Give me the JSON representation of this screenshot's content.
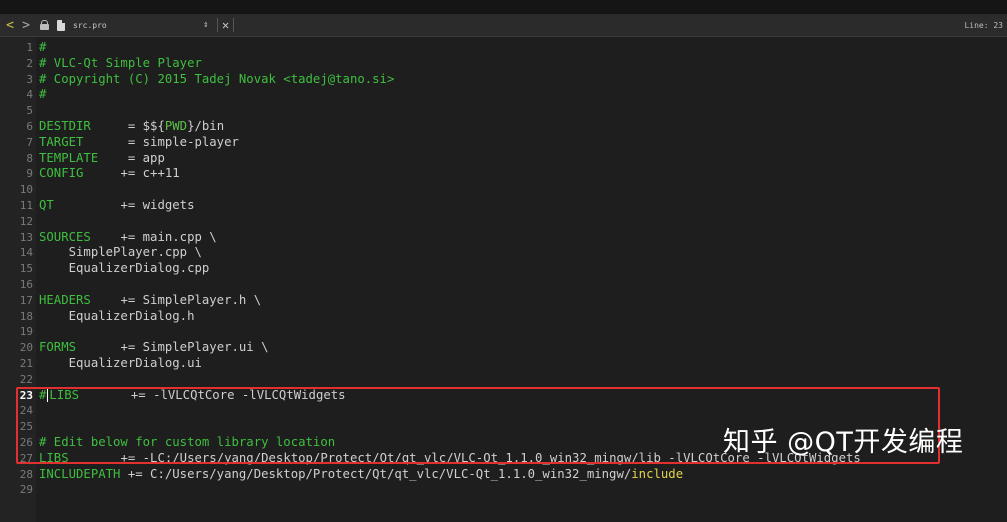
{
  "titlebar": {
    "back_glyph": "<",
    "forward_glyph": ">",
    "filename": "src.pro",
    "updown_glyph": "⇕",
    "close_glyph": "✕",
    "line_status": "Line: 23"
  },
  "editor": {
    "current_line": 23,
    "lines": [
      {
        "n": "1",
        "segs": [
          {
            "t": "#",
            "c": "c-comment"
          }
        ]
      },
      {
        "n": "2",
        "segs": [
          {
            "t": "# VLC-Qt Simple Player",
            "c": "c-comment"
          }
        ]
      },
      {
        "n": "3",
        "segs": [
          {
            "t": "# Copyright (C) 2015 Tadej Novak <tadej@tano.si>",
            "c": "c-comment"
          }
        ]
      },
      {
        "n": "4",
        "segs": [
          {
            "t": "#",
            "c": "c-comment"
          }
        ]
      },
      {
        "n": "5",
        "segs": []
      },
      {
        "n": "6",
        "segs": [
          {
            "t": "DESTDIR",
            "c": "c-var"
          },
          {
            "t": "     = $${",
            "c": "c-plain"
          },
          {
            "t": "PWD",
            "c": "c-pwd"
          },
          {
            "t": "}/bin",
            "c": "c-plain"
          }
        ]
      },
      {
        "n": "7",
        "segs": [
          {
            "t": "TARGET",
            "c": "c-var"
          },
          {
            "t": "      = simple-player",
            "c": "c-plain"
          }
        ]
      },
      {
        "n": "8",
        "segs": [
          {
            "t": "TEMPLATE",
            "c": "c-var"
          },
          {
            "t": "    = app",
            "c": "c-plain"
          }
        ]
      },
      {
        "n": "9",
        "segs": [
          {
            "t": "CONFIG",
            "c": "c-var"
          },
          {
            "t": "     += c++11",
            "c": "c-plain"
          }
        ]
      },
      {
        "n": "10",
        "segs": []
      },
      {
        "n": "11",
        "segs": [
          {
            "t": "QT",
            "c": "c-var"
          },
          {
            "t": "         += widgets",
            "c": "c-plain"
          }
        ]
      },
      {
        "n": "12",
        "segs": []
      },
      {
        "n": "13",
        "segs": [
          {
            "t": "SOURCES",
            "c": "c-var"
          },
          {
            "t": "    += main.cpp \\",
            "c": "c-plain"
          }
        ]
      },
      {
        "n": "14",
        "segs": [
          {
            "t": "    SimplePlayer.cpp \\",
            "c": "c-plain"
          }
        ]
      },
      {
        "n": "15",
        "segs": [
          {
            "t": "    EqualizerDialog.cpp",
            "c": "c-plain"
          }
        ]
      },
      {
        "n": "16",
        "segs": []
      },
      {
        "n": "17",
        "segs": [
          {
            "t": "HEADERS",
            "c": "c-var"
          },
          {
            "t": "    += SimplePlayer.h \\",
            "c": "c-plain"
          }
        ]
      },
      {
        "n": "18",
        "segs": [
          {
            "t": "    EqualizerDialog.h",
            "c": "c-plain"
          }
        ]
      },
      {
        "n": "19",
        "segs": []
      },
      {
        "n": "20",
        "segs": [
          {
            "t": "FORMS",
            "c": "c-var"
          },
          {
            "t": "      += SimplePlayer.ui \\",
            "c": "c-plain"
          }
        ]
      },
      {
        "n": "21",
        "segs": [
          {
            "t": "    EqualizerDialog.ui",
            "c": "c-plain"
          }
        ]
      },
      {
        "n": "22",
        "segs": []
      },
      {
        "n": "23",
        "segs": [
          {
            "t": "#",
            "c": "c-comment"
          },
          {
            "cursor": true
          },
          {
            "t": "LIBS",
            "c": "c-var"
          },
          {
            "t": "       += -lVLCQtCore -lVLCQtWidgets",
            "c": "c-plain"
          }
        ]
      },
      {
        "n": "24",
        "segs": []
      },
      {
        "n": "25",
        "segs": []
      },
      {
        "n": "26",
        "segs": [
          {
            "t": "# Edit below for custom library location",
            "c": "c-comment"
          }
        ]
      },
      {
        "n": "27",
        "segs": [
          {
            "t": "LIBS",
            "c": "c-var"
          },
          {
            "t": "       += -LC:/Users/yang/Desktop/Protect/Qt/qt_vlc/VLC-Qt_1.1.0_win32_mingw/lib -lVLCQtCore -lVLCQtWidgets",
            "c": "c-plain"
          }
        ]
      },
      {
        "n": "28",
        "segs": [
          {
            "t": "INCLUDEPATH",
            "c": "c-var"
          },
          {
            "t": " += C:/Users/yang/Desktop/Protect/Qt/qt_vlc/VLC-Qt_1.1.0_win32_mingw/",
            "c": "c-plain"
          },
          {
            "t": "include",
            "c": "c-yellow"
          }
        ]
      },
      {
        "n": "29",
        "segs": []
      }
    ]
  },
  "watermark": "知乎 @QT开发编程",
  "colors": {
    "background": "#1e1e1e",
    "comment": "#3fbf3f",
    "text": "#cfcfcf",
    "highlight_box": "#e03030"
  }
}
